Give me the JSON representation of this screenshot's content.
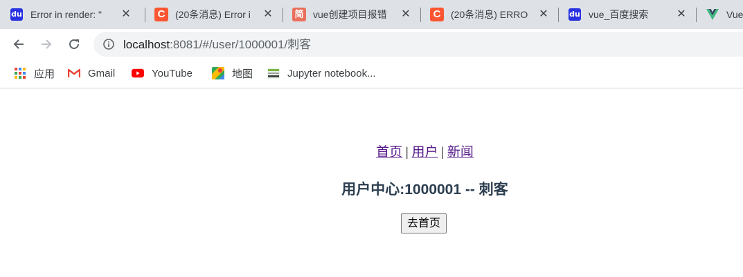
{
  "tabs": [
    {
      "title": "Error in render: \"",
      "favicon": "baidu-paw-icon"
    },
    {
      "title": "(20条消息) Error i",
      "favicon": "csdn-c-icon"
    },
    {
      "title": "vue创建项目报错",
      "favicon": "jianshu-icon"
    },
    {
      "title": "(20条消息) ERRO",
      "favicon": "csdn-c-icon"
    },
    {
      "title": "vue_百度搜索",
      "favicon": "baidu-paw-icon"
    },
    {
      "title": "Vue",
      "favicon": "vue-logo-icon"
    }
  ],
  "favicon_glyphs": {
    "baidu": "du",
    "csdn": "C",
    "jianshu": "简"
  },
  "close_glyph": "✕",
  "address": {
    "host": "localhost",
    "rest": ":8081/#/user/1000001/刺客"
  },
  "bookmarks": [
    {
      "label": "应用",
      "icon": "apps-grid-icon"
    },
    {
      "label": "Gmail",
      "icon": "gmail-icon"
    },
    {
      "label": "YouTube",
      "icon": "youtube-icon"
    },
    {
      "label": "地图",
      "icon": "maps-icon"
    },
    {
      "label": "Jupyter notebook...",
      "icon": "jupyter-icon"
    }
  ],
  "page": {
    "nav": [
      {
        "label": "首页"
      },
      {
        "label": "用户"
      },
      {
        "label": "新闻"
      }
    ],
    "nav_separator": "|",
    "heading": "用户中心:1000001 -- 刺客",
    "button_label": "去首页"
  },
  "colors": {
    "tabstrip": "#dee1e6",
    "link_visited": "#551a8b",
    "heading": "#2c3e50",
    "csdn": "#fc5531",
    "baidu": "#2932e1",
    "jianshu": "#ea6f5a",
    "vue": "#41b883"
  }
}
